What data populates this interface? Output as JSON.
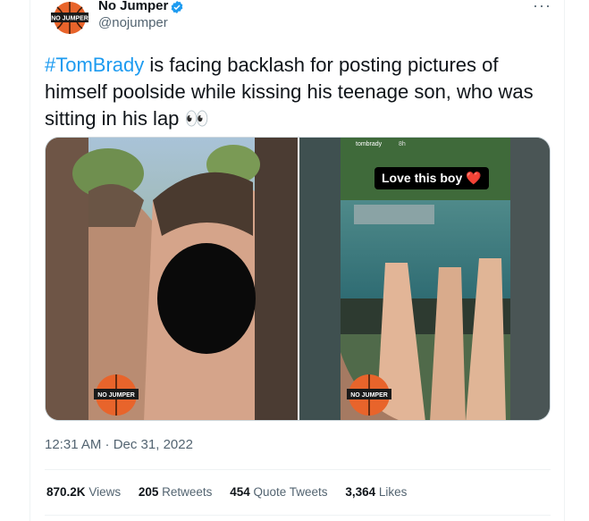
{
  "author": {
    "name": "No Jumper",
    "handle": "@nojumper",
    "avatar_text": "NO JUMPER"
  },
  "tweet": {
    "hashtag": "#TomBrady",
    "text": " is facing backlash for posting pictures of himself poolside while kissing his teenage son, who was sitting in his lap",
    "emoji": "👀"
  },
  "media": {
    "watermark": "NO JUMPER",
    "story_user": "tombrady",
    "story_time": "8h",
    "story_caption": "Love this boy",
    "story_emoji": "❤️"
  },
  "meta": {
    "timestamp": "12:31 AM · Dec 31, 2022"
  },
  "stats": [
    {
      "value": "870.2K",
      "label": "Views"
    },
    {
      "value": "205",
      "label": "Retweets"
    },
    {
      "value": "454",
      "label": "Quote Tweets"
    },
    {
      "value": "3,364",
      "label": "Likes"
    }
  ],
  "colors": {
    "link": "#1d9bf0",
    "verified": "#1d9bf0",
    "secondary_text": "#536471",
    "brand_orange": "#e8642b"
  }
}
